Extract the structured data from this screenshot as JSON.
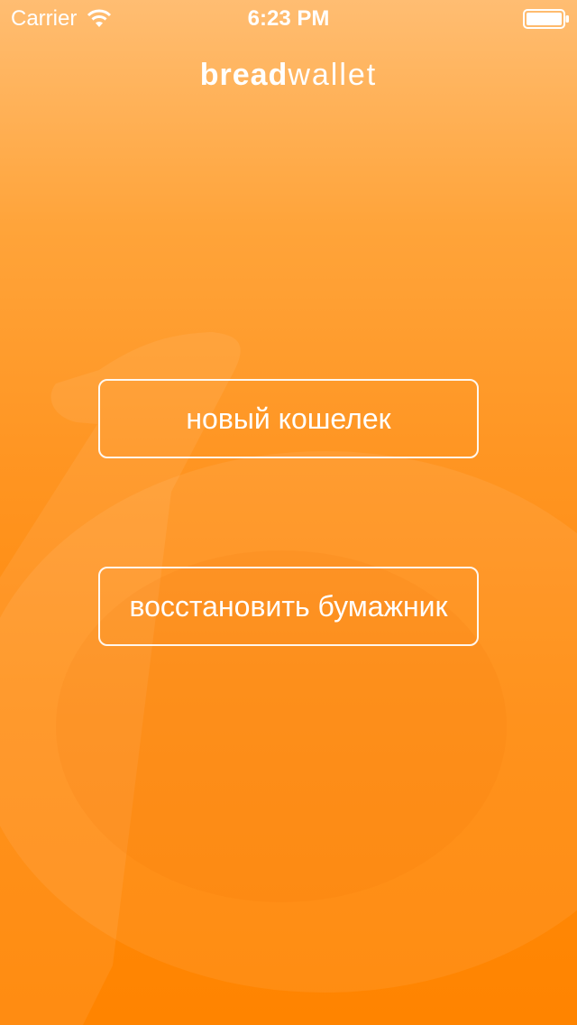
{
  "status_bar": {
    "carrier": "Carrier",
    "time": "6:23 PM",
    "wifi_icon": "wifi-icon",
    "battery_icon": "battery-icon"
  },
  "brand": {
    "bold": "bread",
    "light": "wallet"
  },
  "buttons": {
    "new_wallet": "новый кошелек",
    "recover_wallet": "восстановить бумажник"
  },
  "colors": {
    "gradient_top": "#ffbd72",
    "gradient_bottom": "#ff8400",
    "text": "#ffffff"
  }
}
